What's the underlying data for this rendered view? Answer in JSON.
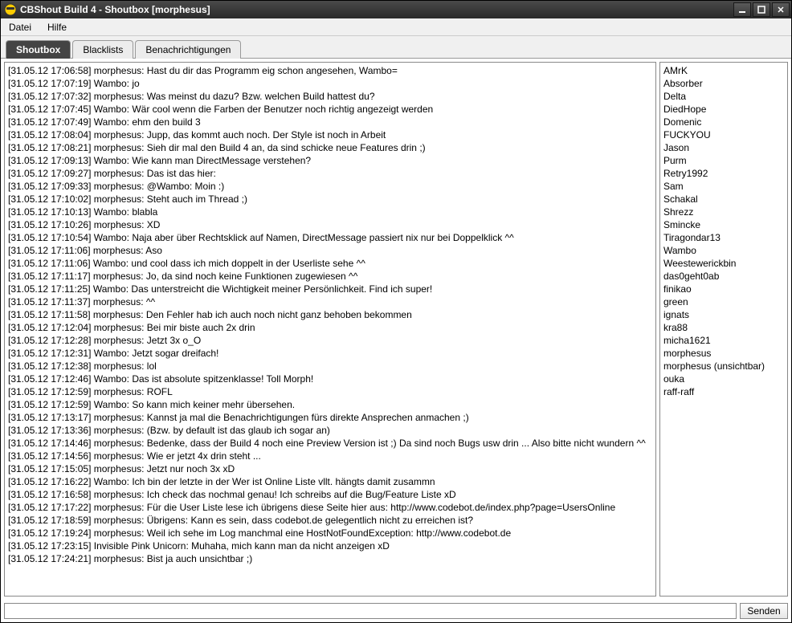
{
  "window": {
    "title": "CBShout Build 4 - Shoutbox [morphesus]"
  },
  "menu": {
    "file": "Datei",
    "help": "Hilfe"
  },
  "tabs": {
    "shoutbox": "Shoutbox",
    "blacklists": "Blacklists",
    "notifications": "Benachrichtigungen"
  },
  "chat": {
    "messages": [
      "[31.05.12 17:06:58] morphesus: Hast du dir das Programm eig schon angesehen, Wambo=",
      "[31.05.12 17:07:19] Wambo: jo",
      "[31.05.12 17:07:32] morphesus: Was meinst du dazu? Bzw. welchen Build hattest du?",
      "[31.05.12 17:07:45] Wambo: Wär cool wenn die Farben der Benutzer noch richtig angezeigt werden",
      "[31.05.12 17:07:49] Wambo: ehm den build 3",
      "[31.05.12 17:08:04] morphesus: Jupp, das kommt auch noch. Der Style ist noch in Arbeit",
      "[31.05.12 17:08:21] morphesus: Sieh dir mal den Build 4 an, da sind schicke neue Features drin ;)",
      "[31.05.12 17:09:13] Wambo: Wie kann man DirectMessage verstehen?",
      "[31.05.12 17:09:27] morphesus: Das ist das hier:",
      "[31.05.12 17:09:33] morphesus: @Wambo: Moin :)",
      "[31.05.12 17:10:02] morphesus: Steht auch im Thread ;)",
      "[31.05.12 17:10:13] Wambo: blabla",
      "[31.05.12 17:10:26] morphesus: XD",
      "[31.05.12 17:10:54] Wambo: Naja aber über Rechtsklick auf Namen, DirectMessage passiert nix nur bei Doppelklick ^^",
      "[31.05.12 17:11:06] morphesus: Aso",
      "[31.05.12 17:11:06] Wambo: und cool dass ich mich doppelt in der Userliste sehe ^^",
      "[31.05.12 17:11:17] morphesus: Jo, da sind noch keine Funktionen zugewiesen ^^",
      "[31.05.12 17:11:25] Wambo: Das unterstreicht die Wichtigkeit meiner Persönlichkeit. Find ich super!",
      "[31.05.12 17:11:37] morphesus: ^^",
      "[31.05.12 17:11:58] morphesus: Den Fehler hab ich auch noch nicht ganz behoben bekommen",
      "[31.05.12 17:12:04] morphesus: Bei mir biste auch 2x drin",
      "[31.05.12 17:12:28] morphesus: Jetzt 3x o_O",
      "[31.05.12 17:12:31] Wambo: Jetzt sogar dreifach!",
      "[31.05.12 17:12:38] morphesus: lol",
      "[31.05.12 17:12:46] Wambo: Das ist absolute spitzenklasse! Toll Morph!",
      "[31.05.12 17:12:59] morphesus: ROFL",
      "[31.05.12 17:12:59] Wambo: So kann mich keiner mehr übersehen.",
      "[31.05.12 17:13:17] morphesus: Kannst ja mal die Benachrichtigungen fürs direkte Ansprechen anmachen ;)",
      "[31.05.12 17:13:36] morphesus: (Bzw. by default ist das glaub ich sogar an)",
      "[31.05.12 17:14:46] morphesus: Bedenke, dass der Build 4 noch eine Preview Version ist ;) Da sind noch Bugs usw drin ... Also bitte nicht wundern ^^",
      "[31.05.12 17:14:56] morphesus: Wie er jetzt 4x drin steht ...",
      "[31.05.12 17:15:05] morphesus: Jetzt nur noch 3x xD",
      "[31.05.12 17:16:22] Wambo: Ich bin der letzte in der Wer ist Online Liste vllt. hängts damit zusammn",
      "[31.05.12 17:16:58] morphesus: Ich check das nochmal genau! Ich schreibs auf die Bug/Feature Liste xD",
      "[31.05.12 17:17:22] morphesus: Für die User Liste lese ich übrigens diese Seite hier aus: http://www.codebot.de/index.php?page=UsersOnline",
      "[31.05.12 17:18:59] morphesus: Übrigens: Kann es sein, dass codebot.de gelegentlich nicht zu erreichen ist?",
      "[31.05.12 17:19:24] morphesus: Weil ich sehe im Log manchmal eine HostNotFoundException: http://www.codebot.de",
      "[31.05.12 17:23:15] Invisible Pink Unicorn: Muhaha, mich kann man da nicht anzeigen xD",
      "[31.05.12 17:24:21] morphesus: Bist ja auch unsichtbar ;)"
    ]
  },
  "users": [
    "AMrK",
    "Absorber",
    "Delta",
    "DiedHope",
    "Domenic",
    "FUCKYOU",
    "Jason",
    "Purm",
    "Retry1992",
    "Sam",
    "Schakal",
    "Shrezz",
    "Smincke",
    "Tiragondar13",
    "Wambo",
    "Weestewerickbin",
    "das0geht0ab",
    "finikao",
    "green",
    "ignats",
    "kra88",
    "micha1621",
    "morphesus",
    "morphesus (unsichtbar)",
    "ouka",
    "raff-raff"
  ],
  "input": {
    "placeholder": "",
    "send": "Senden"
  }
}
